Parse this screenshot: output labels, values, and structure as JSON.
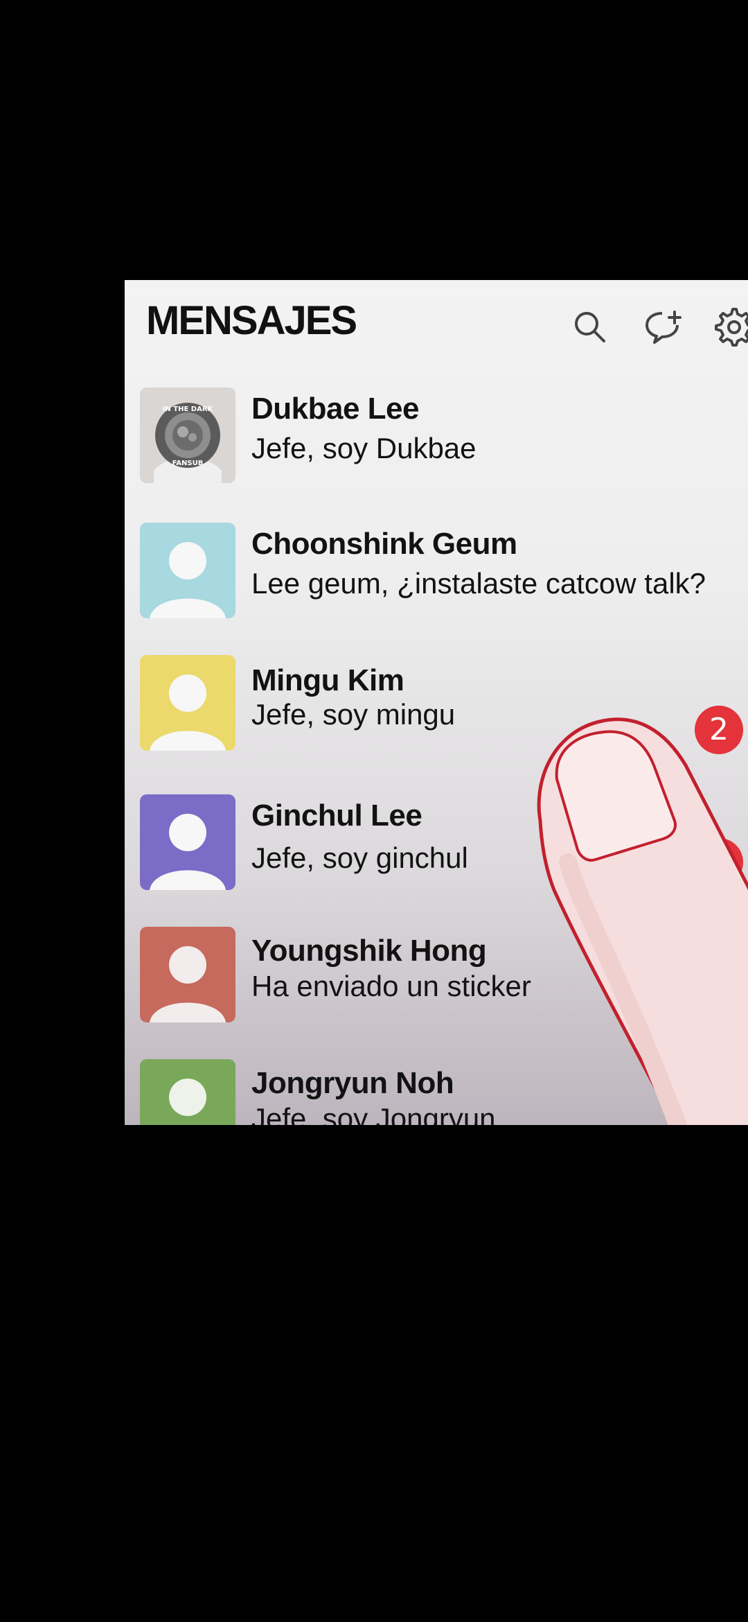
{
  "header": {
    "title": "MENSAJES",
    "icons": [
      "search-icon",
      "new-chat-icon",
      "settings-icon"
    ]
  },
  "conversations": [
    {
      "name": "Dukbae Lee",
      "message": "Jefe, soy Dukbae",
      "avatar": "fansub-logo",
      "avatar_color": "#d9d6d3",
      "badge": ""
    },
    {
      "name": "Choonshink Geum",
      "message": "Lee geum, ¿instalaste catcow talk?",
      "avatar": "default-person",
      "avatar_color": "#a8d8e0",
      "badge": ""
    },
    {
      "name": "Mingu Kim",
      "message": "Jefe, soy mingu",
      "avatar": "default-person",
      "avatar_color": "#ebd96c",
      "badge": "2"
    },
    {
      "name": "Ginchul Lee",
      "message": "Jefe, soy ginchul",
      "avatar": "default-person",
      "avatar_color": "#7a6cc7",
      "badge": "1"
    },
    {
      "name": "Youngshik Hong",
      "message": "Ha enviado un sticker",
      "avatar": "default-person",
      "avatar_color": "#c66a5e",
      "badge": ""
    },
    {
      "name": "Jongryun Noh",
      "message": "Jefe, soy Jongryun",
      "avatar": "default-person",
      "avatar_color": "#7aa85a",
      "badge": ""
    }
  ],
  "logo_text": "IN THE DARK FANSUB",
  "colors": {
    "badge": "#e4333a",
    "background": "#000000",
    "panel": "#f3f3f3"
  }
}
